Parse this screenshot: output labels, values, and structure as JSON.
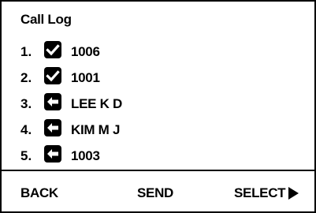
{
  "screen": {
    "title": "Call Log"
  },
  "calls": [
    {
      "index": "1.",
      "icon": "check-icon",
      "label": "1006"
    },
    {
      "index": "2.",
      "icon": "check-icon",
      "label": "1001"
    },
    {
      "index": "3.",
      "icon": "arrow-left-icon",
      "label": "LEE K D"
    },
    {
      "index": "4.",
      "icon": "arrow-left-icon",
      "label": "KIM M J"
    },
    {
      "index": "5.",
      "icon": "arrow-left-icon",
      "label": "1003"
    }
  ],
  "softkeys": {
    "back": "BACK",
    "send": "SEND",
    "select": "SELECT",
    "select_icon": "play-icon"
  },
  "colors": {
    "foreground": "#000000",
    "background": "#ffffff"
  }
}
